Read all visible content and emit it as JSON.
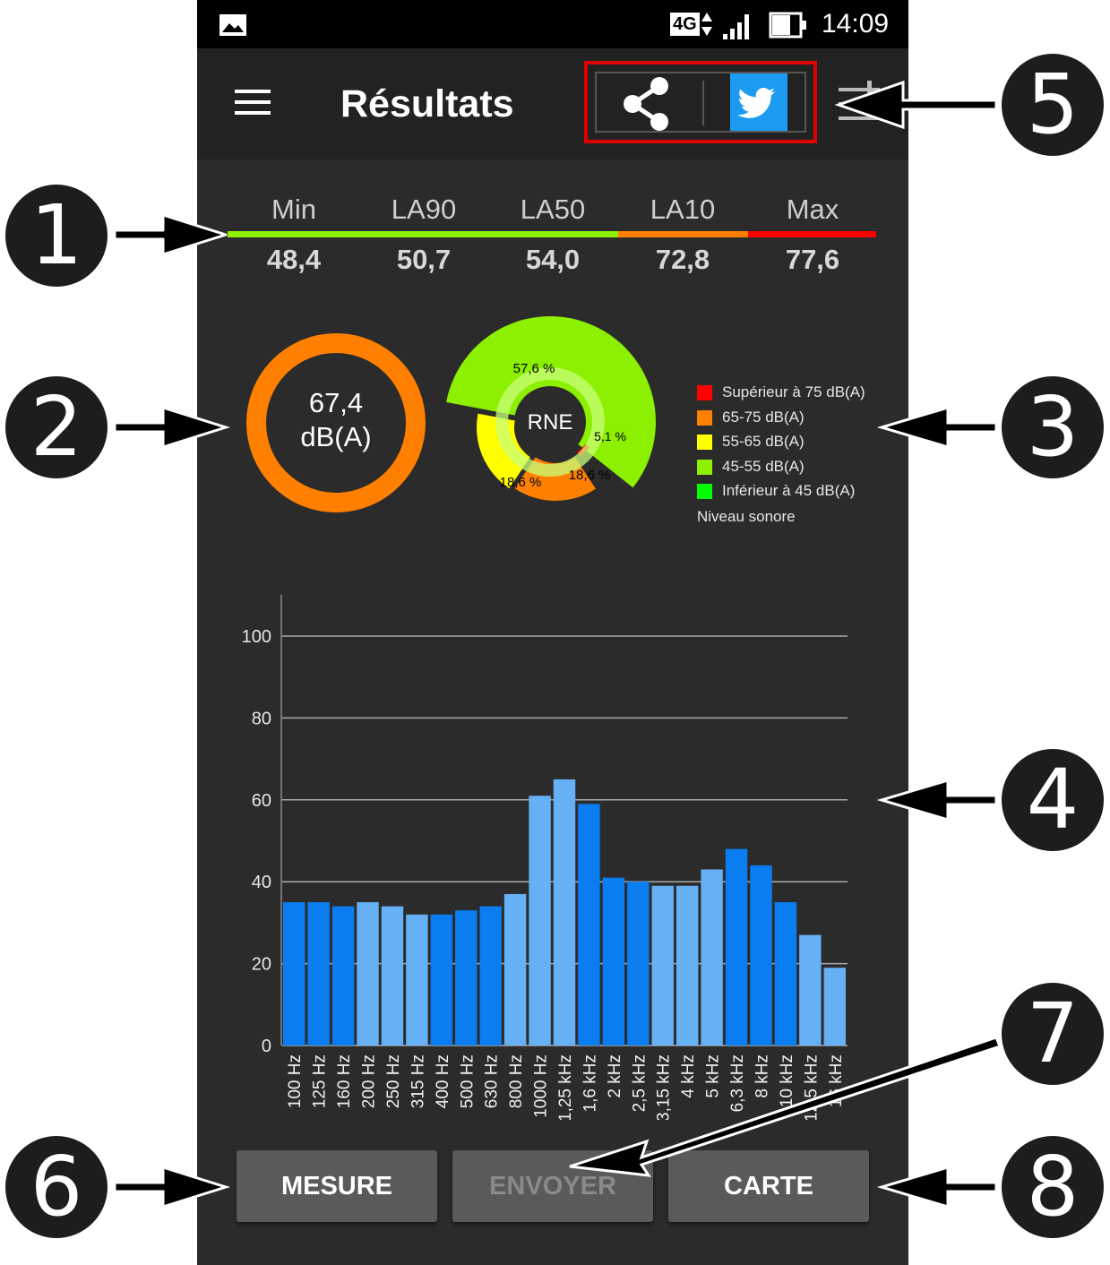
{
  "status_bar": {
    "network": "4G",
    "time": "14:09"
  },
  "app_bar": {
    "title": "Résultats"
  },
  "stats": [
    {
      "label": "Min",
      "value": "48,4"
    },
    {
      "label": "LA90",
      "value": "50,7"
    },
    {
      "label": "LA50",
      "value": "54,0"
    },
    {
      "label": "LA10",
      "value": "72,8"
    },
    {
      "label": "Max",
      "value": "77,6"
    }
  ],
  "level_gauge": {
    "value": "67,4",
    "unit": "dB(A)",
    "color": "#ff8000"
  },
  "pie": {
    "center_label": "RNE",
    "slices": [
      {
        "label": "57,6 %",
        "value": 57.6,
        "color": "#8cf000"
      },
      {
        "label": "5,1 %",
        "value": 5.1,
        "color": "#ff0000"
      },
      {
        "label": "18,6 %",
        "value": 18.6,
        "color": "#ff8000"
      },
      {
        "label": "18,6 %",
        "value": 18.6,
        "color": "#ffff00"
      }
    ]
  },
  "legend": {
    "items": [
      {
        "label": "Supérieur à 75 dB(A)",
        "color": "#ff0000"
      },
      {
        "label": "65-75 dB(A)",
        "color": "#ff8000"
      },
      {
        "label": "55-65 dB(A)",
        "color": "#ffff00"
      },
      {
        "label": "45-55 dB(A)",
        "color": "#8cf000"
      },
      {
        "label": "Inférieur à 45 dB(A)",
        "color": "#00ff00"
      }
    ],
    "title": "Niveau sonore"
  },
  "chart_data": {
    "type": "bar",
    "categories": [
      "100 Hz",
      "125 Hz",
      "160 Hz",
      "200 Hz",
      "250 Hz",
      "315 Hz",
      "400 Hz",
      "500 Hz",
      "630 Hz",
      "800 Hz",
      "1000 Hz",
      "1,25 kHz",
      "1,6 kHz",
      "2 kHz",
      "2,5 kHz",
      "3,15 kHz",
      "4 kHz",
      "5 kHz",
      "6,3 kHz",
      "8 kHz",
      "10 kHz",
      "12,5 kHz",
      "16 kHz"
    ],
    "values": [
      35,
      35,
      34,
      35,
      34,
      32,
      32,
      33,
      34,
      37,
      61,
      65,
      59,
      41,
      40,
      39,
      39,
      43,
      48,
      44,
      35,
      27,
      19
    ],
    "y_ticks": [
      "0",
      "20",
      "40",
      "60",
      "80",
      "100"
    ],
    "ylim": [
      0,
      100
    ],
    "colors": [
      "#0a7df0",
      "#0a7df0",
      "#0a7df0",
      "#66b0f5",
      "#66b0f5",
      "#66b0f5",
      "#0a7df0",
      "#0a7df0",
      "#0a7df0",
      "#66b0f5",
      "#66b0f5",
      "#66b0f5",
      "#0a7df0",
      "#0a7df0",
      "#0a7df0",
      "#66b0f5",
      "#66b0f5",
      "#66b0f5",
      "#0a7df0",
      "#0a7df0",
      "#0a7df0",
      "#66b0f5",
      "#66b0f5"
    ],
    "grid": true
  },
  "buttons": {
    "measure": "MESURE",
    "send": "ENVOYER",
    "map": "CARTE"
  },
  "callouts": [
    "1",
    "2",
    "3",
    "4",
    "5",
    "6",
    "7",
    "8"
  ]
}
